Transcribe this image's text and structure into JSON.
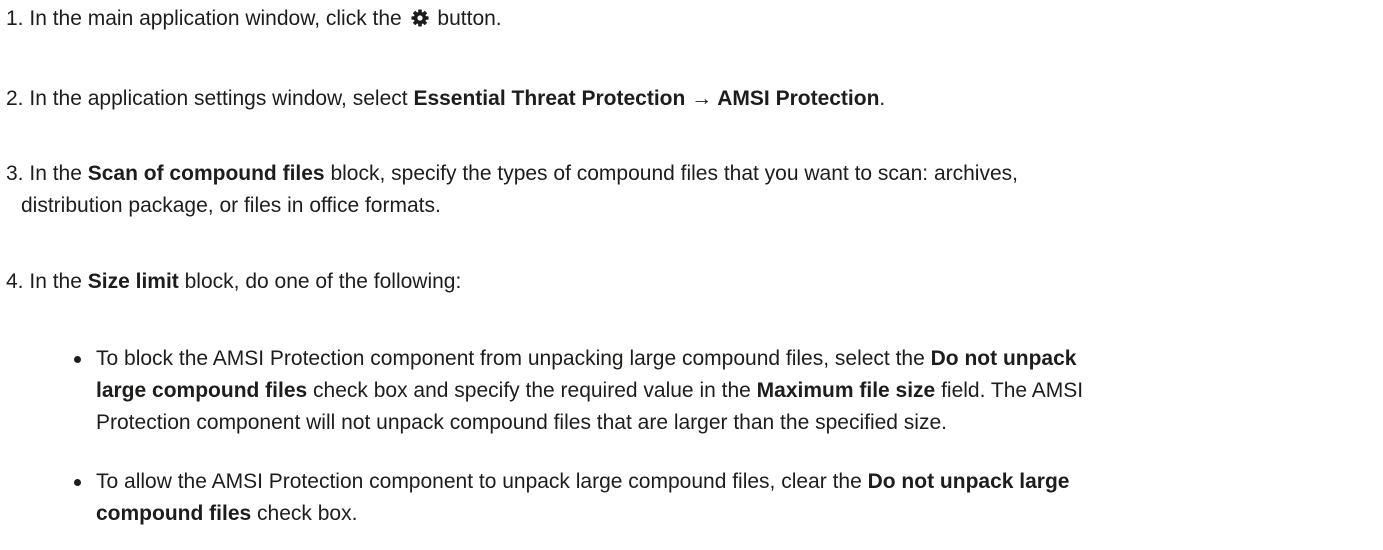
{
  "steps": [
    {
      "num": "1.",
      "parts": [
        "In the main application window, click the",
        "button."
      ],
      "icon": "gear-icon"
    },
    {
      "num": "2.",
      "parts": [
        "In the application settings window, select",
        "Essential Threat Protection → AMSI Protection",
        "."
      ]
    },
    {
      "num": "3.",
      "parts": [
        "In the",
        "Scan of compound files",
        "block, specify the types of compound files that you want to scan: archives,",
        "distribution package, or files in office formats."
      ]
    },
    {
      "num": "4.",
      "parts": [
        "In the",
        "Size limit",
        "block, do one of the following:"
      ]
    }
  ],
  "bullets": [
    {
      "parts": [
        "To block the AMSI Protection component from unpacking large compound files, select the",
        "Do not unpack",
        "large compound files",
        "check box and specify the required value in the",
        "Maximum file size",
        "field. The AMSI",
        "Protection component will not unpack compound files that are larger than the specified size."
      ]
    },
    {
      "parts": [
        "To allow the AMSI Protection component to unpack large compound files, clear the",
        "Do not unpack large",
        "compound files",
        "check box."
      ]
    }
  ]
}
